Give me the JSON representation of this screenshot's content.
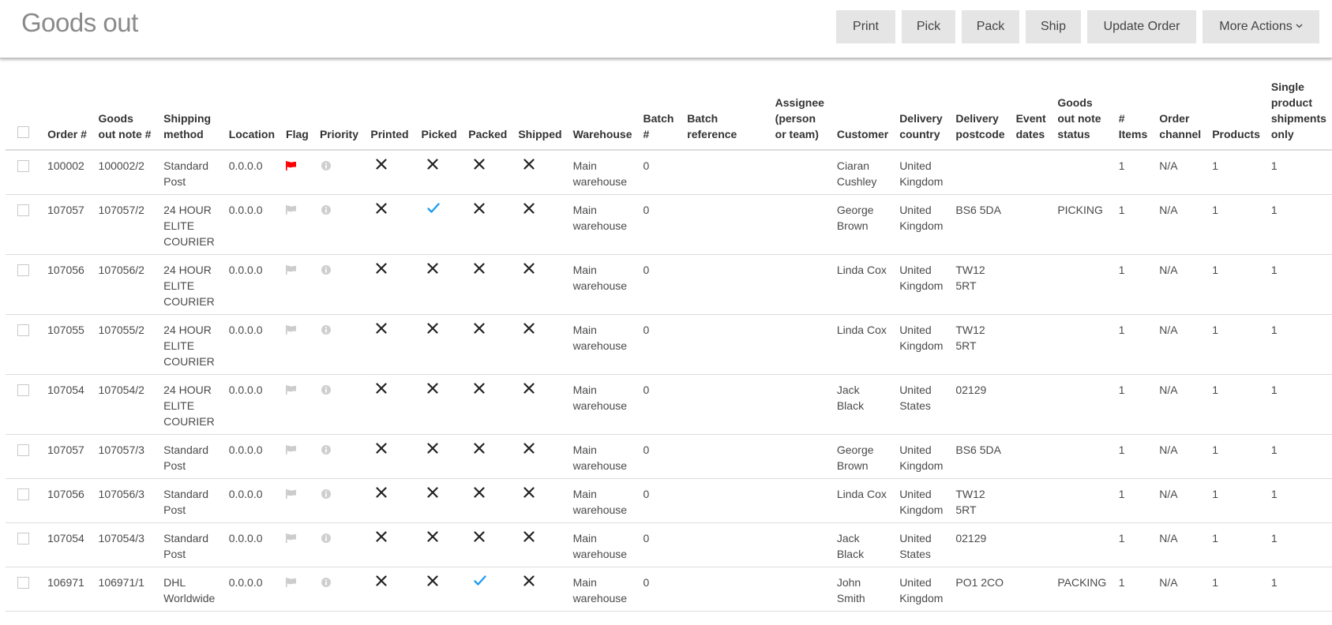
{
  "header": {
    "title": "Goods out",
    "buttons": {
      "print": "Print",
      "pick": "Pick",
      "pack": "Pack",
      "ship": "Ship",
      "update_order": "Update Order",
      "more_actions": "More Actions"
    }
  },
  "colors": {
    "flag_active": "#ff0000",
    "flag_inactive": "#cccccc",
    "check": "#1e9bf0",
    "cross": "#222222"
  },
  "table": {
    "columns": [
      "Order #",
      "Goods out note #",
      "Shipping method",
      "Location",
      "Flag",
      "Priority",
      "Printed",
      "Picked",
      "Packed",
      "Shipped",
      "Warehouse",
      "Batch #",
      "Batch reference",
      "Assignee (person or team)",
      "Customer",
      "Delivery country",
      "Delivery postcode",
      "Event dates",
      "Goods out note status",
      "# Items",
      "Order channel",
      "Products",
      "Single product shipments only"
    ],
    "rows": [
      {
        "order": "100002",
        "note": "100002/2",
        "shipping": "Standard Post",
        "location": "0.0.0.0",
        "flagged": true,
        "printed": false,
        "picked": false,
        "packed": false,
        "shipped": false,
        "warehouse": "Main warehouse",
        "batch": "0",
        "batch_ref": "",
        "assignee": "",
        "customer": "Ciaran Cushley",
        "country": "United Kingdom",
        "postcode": "",
        "event_dates": "",
        "status": "",
        "items": "1",
        "channel": "N/A",
        "products": "1",
        "single": "1"
      },
      {
        "order": "107057",
        "note": "107057/2",
        "shipping": "24 HOUR ELITE COURIER",
        "location": "0.0.0.0",
        "flagged": false,
        "printed": false,
        "picked": true,
        "packed": false,
        "shipped": false,
        "warehouse": "Main warehouse",
        "batch": "0",
        "batch_ref": "",
        "assignee": "",
        "customer": "George Brown",
        "country": "United Kingdom",
        "postcode": "BS6 5DA",
        "event_dates": "",
        "status": "PICKING",
        "items": "1",
        "channel": "N/A",
        "products": "1",
        "single": "1"
      },
      {
        "order": "107056",
        "note": "107056/2",
        "shipping": "24 HOUR ELITE COURIER",
        "location": "0.0.0.0",
        "flagged": false,
        "printed": false,
        "picked": false,
        "packed": false,
        "shipped": false,
        "warehouse": "Main warehouse",
        "batch": "0",
        "batch_ref": "",
        "assignee": "",
        "customer": "Linda Cox",
        "country": "United Kingdom",
        "postcode": "TW12 5RT",
        "event_dates": "",
        "status": "",
        "items": "1",
        "channel": "N/A",
        "products": "1",
        "single": "1"
      },
      {
        "order": "107055",
        "note": "107055/2",
        "shipping": "24 HOUR ELITE COURIER",
        "location": "0.0.0.0",
        "flagged": false,
        "printed": false,
        "picked": false,
        "packed": false,
        "shipped": false,
        "warehouse": "Main warehouse",
        "batch": "0",
        "batch_ref": "",
        "assignee": "",
        "customer": "Linda Cox",
        "country": "United Kingdom",
        "postcode": "TW12 5RT",
        "event_dates": "",
        "status": "",
        "items": "1",
        "channel": "N/A",
        "products": "1",
        "single": "1"
      },
      {
        "order": "107054",
        "note": "107054/2",
        "shipping": "24 HOUR ELITE COURIER",
        "location": "0.0.0.0",
        "flagged": false,
        "printed": false,
        "picked": false,
        "packed": false,
        "shipped": false,
        "warehouse": "Main warehouse",
        "batch": "0",
        "batch_ref": "",
        "assignee": "",
        "customer": "Jack Black",
        "country": "United States",
        "postcode": "02129",
        "event_dates": "",
        "status": "",
        "items": "1",
        "channel": "N/A",
        "products": "1",
        "single": "1"
      },
      {
        "order": "107057",
        "note": "107057/3",
        "shipping": "Standard Post",
        "location": "0.0.0.0",
        "flagged": false,
        "printed": false,
        "picked": false,
        "packed": false,
        "shipped": false,
        "warehouse": "Main warehouse",
        "batch": "0",
        "batch_ref": "",
        "assignee": "",
        "customer": "George Brown",
        "country": "United Kingdom",
        "postcode": "BS6 5DA",
        "event_dates": "",
        "status": "",
        "items": "1",
        "channel": "N/A",
        "products": "1",
        "single": "1"
      },
      {
        "order": "107056",
        "note": "107056/3",
        "shipping": "Standard Post",
        "location": "0.0.0.0",
        "flagged": false,
        "printed": false,
        "picked": false,
        "packed": false,
        "shipped": false,
        "warehouse": "Main warehouse",
        "batch": "0",
        "batch_ref": "",
        "assignee": "",
        "customer": "Linda Cox",
        "country": "United Kingdom",
        "postcode": "TW12 5RT",
        "event_dates": "",
        "status": "",
        "items": "1",
        "channel": "N/A",
        "products": "1",
        "single": "1"
      },
      {
        "order": "107054",
        "note": "107054/3",
        "shipping": "Standard Post",
        "location": "0.0.0.0",
        "flagged": false,
        "printed": false,
        "picked": false,
        "packed": false,
        "shipped": false,
        "warehouse": "Main warehouse",
        "batch": "0",
        "batch_ref": "",
        "assignee": "",
        "customer": "Jack Black",
        "country": "United States",
        "postcode": "02129",
        "event_dates": "",
        "status": "",
        "items": "1",
        "channel": "N/A",
        "products": "1",
        "single": "1"
      },
      {
        "order": "106971",
        "note": "106971/1",
        "shipping": "DHL Worldwide",
        "location": "0.0.0.0",
        "flagged": false,
        "printed": false,
        "picked": false,
        "packed": true,
        "shipped": false,
        "warehouse": "Main warehouse",
        "batch": "0",
        "batch_ref": "",
        "assignee": "",
        "customer": "John Smith",
        "country": "United Kingdom",
        "postcode": "PO1 2CO",
        "event_dates": "",
        "status": "PACKING",
        "items": "1",
        "channel": "N/A",
        "products": "1",
        "single": "1"
      }
    ]
  }
}
